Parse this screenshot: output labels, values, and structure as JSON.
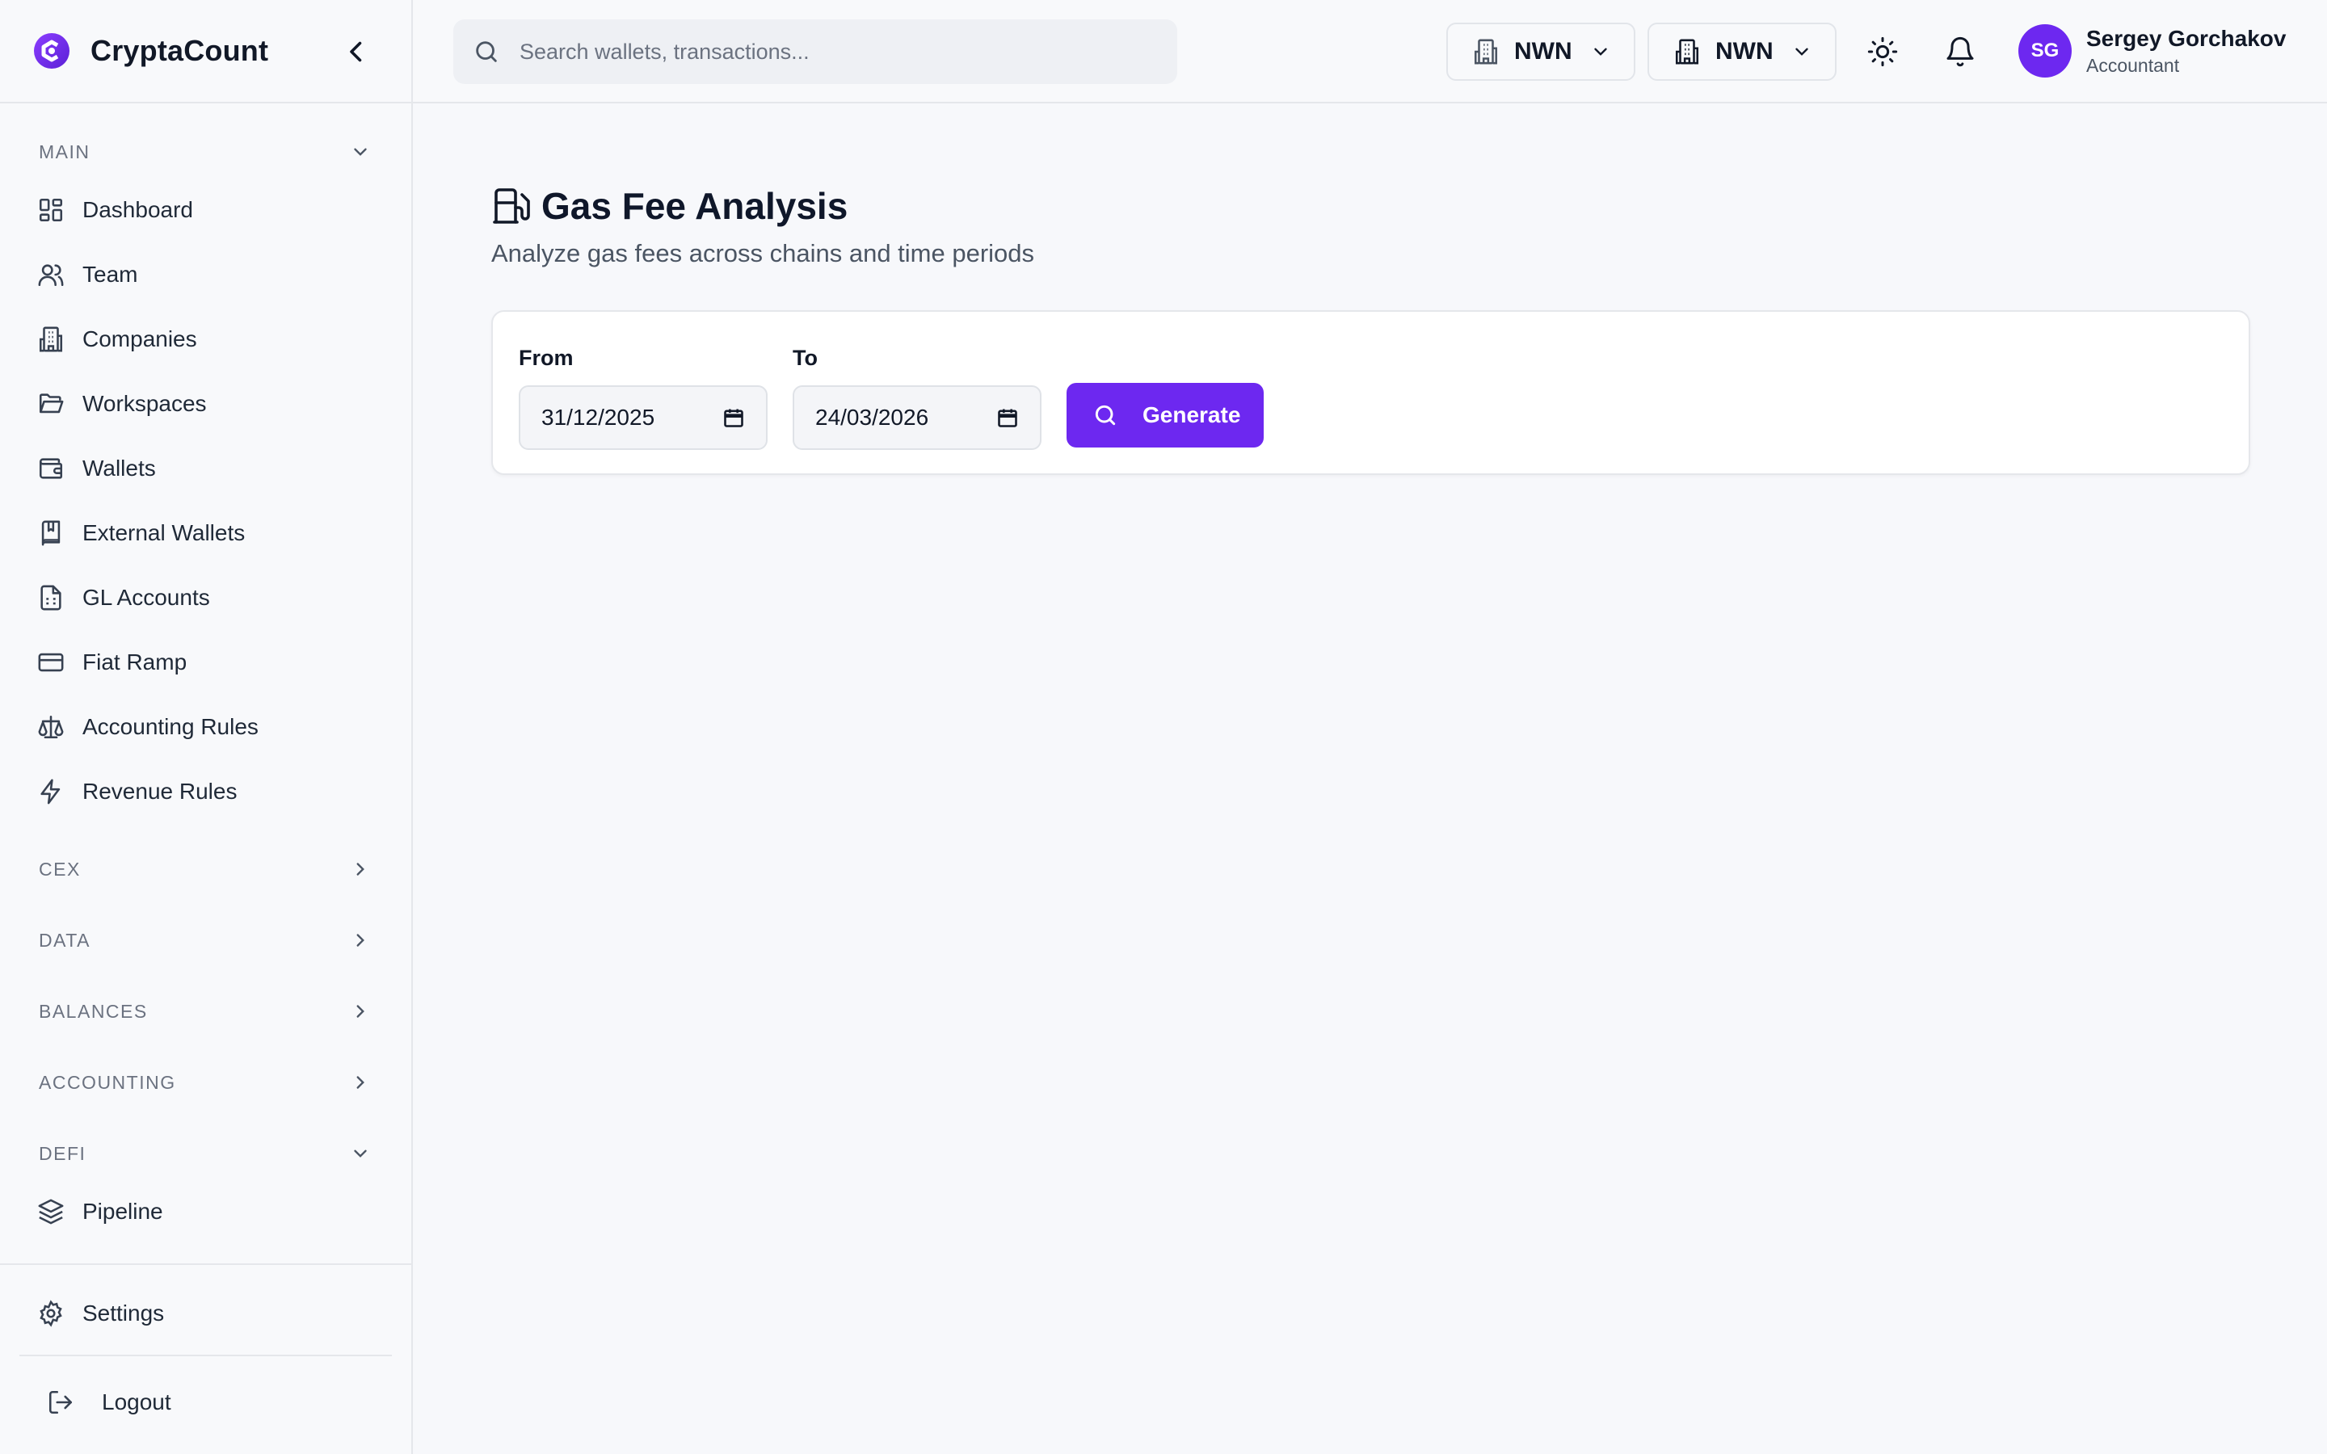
{
  "app": {
    "name": "CryptaCount"
  },
  "sidebar": {
    "main_label": "MAIN",
    "main_items": [
      {
        "label": "Dashboard",
        "icon": "dashboard-icon"
      },
      {
        "label": "Team",
        "icon": "users-icon"
      },
      {
        "label": "Companies",
        "icon": "building-icon"
      },
      {
        "label": "Workspaces",
        "icon": "folder-icon"
      },
      {
        "label": "Wallets",
        "icon": "wallet-icon"
      },
      {
        "label": "External Wallets",
        "icon": "book-icon"
      },
      {
        "label": "GL Accounts",
        "icon": "file-spreadsheet-icon"
      },
      {
        "label": "Fiat Ramp",
        "icon": "credit-card-icon"
      },
      {
        "label": "Accounting Rules",
        "icon": "scale-icon"
      },
      {
        "label": "Revenue Rules",
        "icon": "zap-icon"
      }
    ],
    "sections": [
      "CEX",
      "DATA",
      "BALANCES",
      "ACCOUNTING"
    ],
    "defi_label": "DEFI",
    "defi_items": [
      {
        "label": "Pipeline",
        "icon": "layers-icon"
      }
    ],
    "settings_label": "Settings",
    "logout_label": "Logout"
  },
  "topbar": {
    "search_placeholder": "Search wallets, transactions...",
    "org_selector_1": "NWN",
    "org_selector_2": "NWN",
    "user": {
      "initials": "SG",
      "name": "Sergey Gorchakov",
      "role": "Accountant"
    }
  },
  "page": {
    "title": "Gas Fee Analysis",
    "subtitle": "Analyze gas fees across chains and time periods",
    "from_label": "From",
    "from_value": "31/12/2025",
    "to_label": "To",
    "to_value": "24/03/2026",
    "generate_label": "Generate"
  },
  "colors": {
    "accent": "#6d28f0",
    "background": "#f7f8fb"
  }
}
